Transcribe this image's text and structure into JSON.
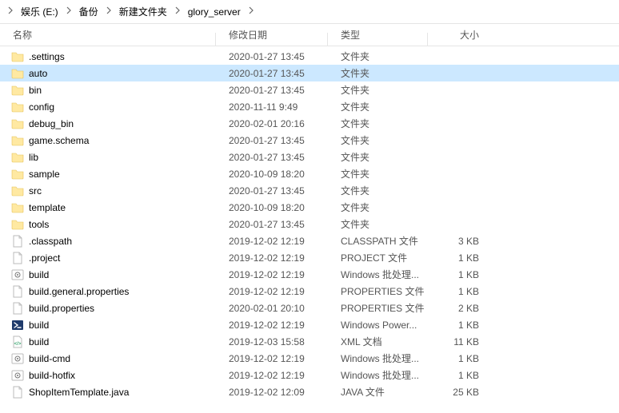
{
  "breadcrumb": [
    {
      "label": "娱乐 (E:)"
    },
    {
      "label": "备份"
    },
    {
      "label": "新建文件夹"
    },
    {
      "label": "glory_server"
    }
  ],
  "columns": {
    "name": "名称",
    "date": "修改日期",
    "type": "类型",
    "size": "大小"
  },
  "files": [
    {
      "icon": "folder",
      "name": ".settings",
      "date": "2020-01-27 13:45",
      "type": "文件夹",
      "size": "",
      "selected": false
    },
    {
      "icon": "folder",
      "name": "auto",
      "date": "2020-01-27 13:45",
      "type": "文件夹",
      "size": "",
      "selected": true
    },
    {
      "icon": "folder",
      "name": "bin",
      "date": "2020-01-27 13:45",
      "type": "文件夹",
      "size": "",
      "selected": false
    },
    {
      "icon": "folder",
      "name": "config",
      "date": "2020-11-11 9:49",
      "type": "文件夹",
      "size": "",
      "selected": false
    },
    {
      "icon": "folder",
      "name": "debug_bin",
      "date": "2020-02-01 20:16",
      "type": "文件夹",
      "size": "",
      "selected": false
    },
    {
      "icon": "folder",
      "name": "game.schema",
      "date": "2020-01-27 13:45",
      "type": "文件夹",
      "size": "",
      "selected": false
    },
    {
      "icon": "folder",
      "name": "lib",
      "date": "2020-01-27 13:45",
      "type": "文件夹",
      "size": "",
      "selected": false
    },
    {
      "icon": "folder",
      "name": "sample",
      "date": "2020-10-09 18:20",
      "type": "文件夹",
      "size": "",
      "selected": false
    },
    {
      "icon": "folder",
      "name": "src",
      "date": "2020-01-27 13:45",
      "type": "文件夹",
      "size": "",
      "selected": false
    },
    {
      "icon": "folder",
      "name": "template",
      "date": "2020-10-09 18:20",
      "type": "文件夹",
      "size": "",
      "selected": false
    },
    {
      "icon": "folder",
      "name": "tools",
      "date": "2020-01-27 13:45",
      "type": "文件夹",
      "size": "",
      "selected": false
    },
    {
      "icon": "file",
      "name": ".classpath",
      "date": "2019-12-02 12:19",
      "type": "CLASSPATH 文件",
      "size": "3 KB",
      "selected": false
    },
    {
      "icon": "file",
      "name": ".project",
      "date": "2019-12-02 12:19",
      "type": "PROJECT 文件",
      "size": "1 KB",
      "selected": false
    },
    {
      "icon": "gear",
      "name": "build",
      "date": "2019-12-02 12:19",
      "type": "Windows 批处理...",
      "size": "1 KB",
      "selected": false
    },
    {
      "icon": "file",
      "name": "build.general.properties",
      "date": "2019-12-02 12:19",
      "type": "PROPERTIES 文件",
      "size": "1 KB",
      "selected": false
    },
    {
      "icon": "file",
      "name": "build.properties",
      "date": "2020-02-01 20:10",
      "type": "PROPERTIES 文件",
      "size": "2 KB",
      "selected": false
    },
    {
      "icon": "ps1",
      "name": "build",
      "date": "2019-12-02 12:19",
      "type": "Windows Power...",
      "size": "1 KB",
      "selected": false
    },
    {
      "icon": "xml",
      "name": "build",
      "date": "2019-12-03 15:58",
      "type": "XML 文档",
      "size": "11 KB",
      "selected": false
    },
    {
      "icon": "gear",
      "name": "build-cmd",
      "date": "2019-12-02 12:19",
      "type": "Windows 批处理...",
      "size": "1 KB",
      "selected": false
    },
    {
      "icon": "gear",
      "name": "build-hotfix",
      "date": "2019-12-02 12:19",
      "type": "Windows 批处理...",
      "size": "1 KB",
      "selected": false
    },
    {
      "icon": "file",
      "name": "ShopItemTemplate.java",
      "date": "2019-12-02 12:09",
      "type": "JAVA 文件",
      "size": "25 KB",
      "selected": false
    }
  ]
}
